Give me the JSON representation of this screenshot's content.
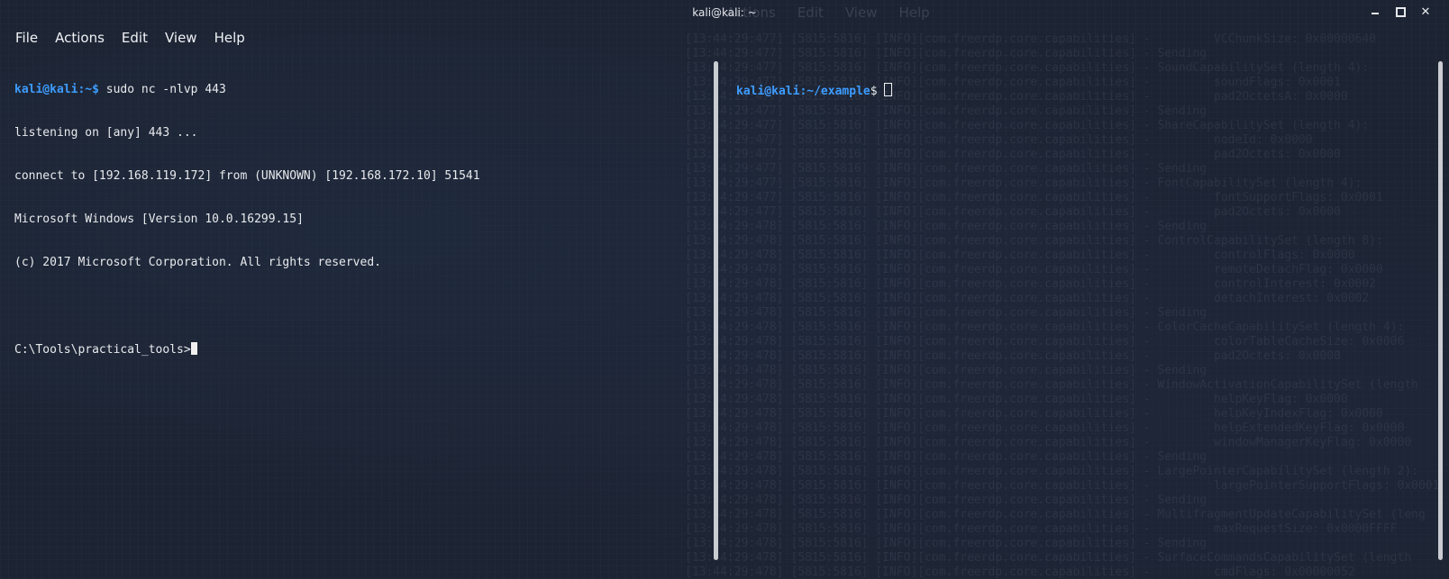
{
  "window": {
    "title": "kali@kali: ~",
    "ghost_menu": [
      "Actions",
      "Edit",
      "View",
      "Help"
    ]
  },
  "menu": [
    "File",
    "Actions",
    "Edit",
    "View",
    "Help"
  ],
  "left_terminal": {
    "prompt_user": "kali@kali",
    "prompt_path": ":~$",
    "command": " sudo nc -nlvp 443",
    "output": [
      "listening on [any] 443 ...",
      "connect to [192.168.119.172] from (UNKNOWN) [192.168.172.10] 51541",
      "Microsoft Windows [Version 10.0.16299.15]",
      "(c) 2017 Microsoft Corporation. All rights reserved."
    ],
    "win_prompt": "C:\\Tools\\practical_tools>"
  },
  "right_terminal": {
    "prompt_user": "kali@kali",
    "prompt_path": ":~/example",
    "prompt_suffix": "$ "
  },
  "ghost_log": [
    "[13:44:29:477] [5815:5816] [INFO][com.freerdp.core.capabilities] -         VCChunkSize: 0x00000640",
    "[13:44:29:477] [5815:5816] [INFO][com.freerdp.core.capabilities] - Sending",
    "[13:44:29:477] [5815:5816] [INFO][com.freerdp.core.capabilities] - SoundCapabilitySet (length 4):",
    "[13:44:29:477] [5815:5816] [INFO][com.freerdp.core.capabilities] -         soundFlags: 0x0001",
    "[13:44:29:477] [5815:5816] [INFO][com.freerdp.core.capabilities] -         pad2OctetsA: 0x0000",
    "[13:44:29:477] [5815:5816] [INFO][com.freerdp.core.capabilities] - Sending",
    "[13:44:29:477] [5815:5816] [INFO][com.freerdp.core.capabilities] - ShareCapabilitySet (length 4):",
    "[13:44:29:477] [5815:5816] [INFO][com.freerdp.core.capabilities] -         nodeId: 0x0000",
    "[13:44:29:477] [5815:5816] [INFO][com.freerdp.core.capabilities] -         pad2Octets: 0x0000",
    "[13:44:29:477] [5815:5816] [INFO][com.freerdp.core.capabilities] - Sending",
    "[13:44:29:477] [5815:5816] [INFO][com.freerdp.core.capabilities] - FontCapabilitySet (length 4):",
    "[13:44:29:477] [5815:5816] [INFO][com.freerdp.core.capabilities] -         fontSupportFlags: 0x0001",
    "[13:44:29:477] [5815:5816] [INFO][com.freerdp.core.capabilities] -         pad2Octets: 0x0000",
    "[13:44:29:478] [5815:5816] [INFO][com.freerdp.core.capabilities] - Sending",
    "[13:44:29:478] [5815:5816] [INFO][com.freerdp.core.capabilities] - ControlCapabilitySet (length 8):",
    "[13:44:29:478] [5815:5816] [INFO][com.freerdp.core.capabilities] -         controlFlags: 0x0000",
    "[13:44:29:478] [5815:5816] [INFO][com.freerdp.core.capabilities] -         remoteDetachFlag: 0x0000",
    "[13:44:29:478] [5815:5816] [INFO][com.freerdp.core.capabilities] -         controlInterest: 0x0002",
    "[13:44:29:478] [5815:5816] [INFO][com.freerdp.core.capabilities] -         detachInterest: 0x0002",
    "[13:44:29:478] [5815:5816] [INFO][com.freerdp.core.capabilities] - Sending",
    "[13:44:29:478] [5815:5816] [INFO][com.freerdp.core.capabilities] - ColorCacheCapabilitySet (length 4):",
    "[13:44:29:478] [5815:5816] [INFO][com.freerdp.core.capabilities] -         colorTableCacheSize: 0x0006",
    "[13:44:29:478] [5815:5816] [INFO][com.freerdp.core.capabilities] -         pad2Octets: 0x0000",
    "[13:44:29:478] [5815:5816] [INFO][com.freerdp.core.capabilities] - Sending",
    "[13:44:29:478] [5815:5816] [INFO][com.freerdp.core.capabilities] - WindowActivationCapabilitySet (length",
    "[13:44:29:478] [5815:5816] [INFO][com.freerdp.core.capabilities] -         helpKeyFlag: 0x0000",
    "[13:44:29:478] [5815:5816] [INFO][com.freerdp.core.capabilities] -         helpKeyIndexFlag: 0x0000",
    "[13:44:29:478] [5815:5816] [INFO][com.freerdp.core.capabilities] -         helpExtendedKeyFlag: 0x0000",
    "[13:44:29:478] [5815:5816] [INFO][com.freerdp.core.capabilities] -         windowManagerKeyFlag: 0x0000",
    "[13:44:29:478] [5815:5816] [INFO][com.freerdp.core.capabilities] - Sending",
    "[13:44:29:478] [5815:5816] [INFO][com.freerdp.core.capabilities] - LargePointerCapabilitySet (length 2):",
    "[13:44:29:478] [5815:5816] [INFO][com.freerdp.core.capabilities] -         largePointerSupportFlags: 0x0001",
    "[13:44:29:478] [5815:5816] [INFO][com.freerdp.core.capabilities] - Sending",
    "[13:44:29:478] [5815:5816] [INFO][com.freerdp.core.capabilities] - MultifragmentUpdateCapabilitySet (leng",
    "[13:44:29:478] [5815:5816] [INFO][com.freerdp.core.capabilities] -         maxRequestSize: 0x0000FFFF",
    "[13:44:29:478] [5815:5816] [INFO][com.freerdp.core.capabilities] - Sending",
    "[13:44:29:478] [5815:5816] [INFO][com.freerdp.core.capabilities] - SurfaceCommandsCapabilitySet (length",
    "[13:44:29:478] [5815:5816] [INFO][com.freerdp.core.capabilities] -         cmdFlags: 0x00000052"
  ]
}
